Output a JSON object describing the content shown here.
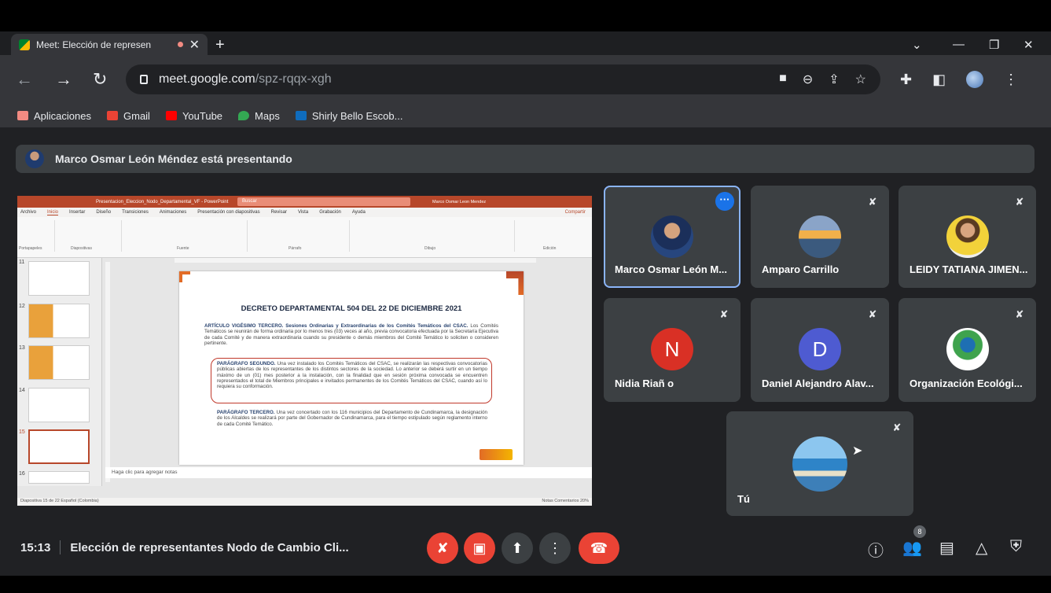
{
  "browser": {
    "tab_title": "Meet: Elección de represen",
    "new_tab": "+",
    "url_host": "meet.google.com",
    "url_path": "/spz-rqqx-xgh",
    "bookmarks": [
      {
        "label": "Aplicaciones",
        "icon": "apps-grid-icon",
        "color": "#f28b82"
      },
      {
        "label": "Gmail",
        "icon": "gmail-icon",
        "color": "#ea4335"
      },
      {
        "label": "YouTube",
        "icon": "youtube-icon",
        "color": "#ff0000"
      },
      {
        "label": "Maps",
        "icon": "maps-pin-icon",
        "color": "#34a853"
      },
      {
        "label": "Shirly Bello Escob...",
        "icon": "outlook-icon",
        "color": "#0f6cbd"
      }
    ]
  },
  "meet": {
    "presenting_banner": "Marco Osmar León Méndez está presentando",
    "clock": "15:13",
    "meeting_title": "Elección de representantes Nodo de Cambio Cli...",
    "participant_count": "8",
    "accent_red": "#ea4335",
    "accent_blue": "#1a73e8"
  },
  "slide_window": {
    "title_bar": "Presentacion_Eleccion_Nodo_Departamental_VF - PowerPoint",
    "search": "Buscar",
    "user": "Marco Osmar Leon Mendez",
    "menu": [
      "Archivo",
      "Inicio",
      "Insertar",
      "Diseño",
      "Transiciones",
      "Animaciones",
      "Presentación con diapositivas",
      "Revisar",
      "Vista",
      "Grabación",
      "Ayuda"
    ],
    "share_label": "Compartir",
    "ribbon_groups": [
      "Portapapeles",
      "Diapositivas",
      "Fuente",
      "Párrafo",
      "Dibujo",
      "Edición"
    ],
    "thumb_numbers": [
      "11",
      "12",
      "13",
      "14",
      "15",
      "16"
    ],
    "slide_heading": "DECRETO DEPARTAMENTAL 504 DEL 22 DE DICIEMBRE 2021",
    "art_title": "ARTÍCULO VIGÉSIMO TERCERO. Sesiones Ordinarias y Extraordinarias de los Comités Temáticos del CSAC.",
    "art_body": "Los Comités Temáticos se reunirán de forma ordinaria por lo menos tres (03) veces al año, previa convocatoria efectuada por la Secretaría Ejecutiva de cada Comité y de manera extraordinaria cuando su presidente o demás miembros del Comité Temático lo soliciten o consideren pertinente.",
    "par2_title": "PARÁGRAFO SEGUNDO.",
    "par2_body": "Una vez instalado los Comités Temáticos del CSAC, se realizarán las respectivas convocatorias públicas abiertas de los representantes de los distintos sectores de la sociedad. Lo anterior se deberá surtir en un tiempo máximo de un (01) mes posterior a la instalación, con la finalidad que en sesión próxima convocada se encuentren representados el total de Miembros principales e invitados permanentes de los Comités Temáticos del CSAC, cuando así lo requiera su conformación.",
    "par3_title": "PARÁGRAFO TERCERO.",
    "par3_body": "Una vez concertado con los 116 municipios del Departamento de Cundinamarca, la designación de los Alcaldes se realizará por parte del Gobernador de Cundinamarca, para el tiempo estipulado según reglamento interno de cada Comité Temático.",
    "notes_placeholder": "Haga clic para agregar notas",
    "status_left": "Diapositiva 15 de 22   Español (Colombia)",
    "status_right": "Notas   Comentarios   20%"
  },
  "participants": [
    {
      "name": "Marco Osmar León M...",
      "kind": "photo",
      "color": "#1f3b6e",
      "muted": false,
      "active": true
    },
    {
      "name": "Amparo Carrillo",
      "kind": "photo",
      "color": "#e8a04a",
      "muted": true,
      "active": false
    },
    {
      "name": "LEIDY TATIANA JIMEN...",
      "kind": "photo",
      "color": "#f2d23a",
      "muted": true,
      "active": false
    },
    {
      "name": "Nidia Riañ o",
      "kind": "letter",
      "letter": "N",
      "color": "#d93025",
      "muted": true,
      "active": false
    },
    {
      "name": "Daniel Alejandro Alav...",
      "kind": "letter",
      "letter": "D",
      "color": "#4e5bd1",
      "muted": true,
      "active": false
    },
    {
      "name": "Organización Ecológi...",
      "kind": "photo",
      "color": "#ffffff",
      "muted": true,
      "active": false
    },
    {
      "name": "Tú",
      "kind": "photo",
      "color": "#3f8fd1",
      "muted": true,
      "active": false
    }
  ]
}
